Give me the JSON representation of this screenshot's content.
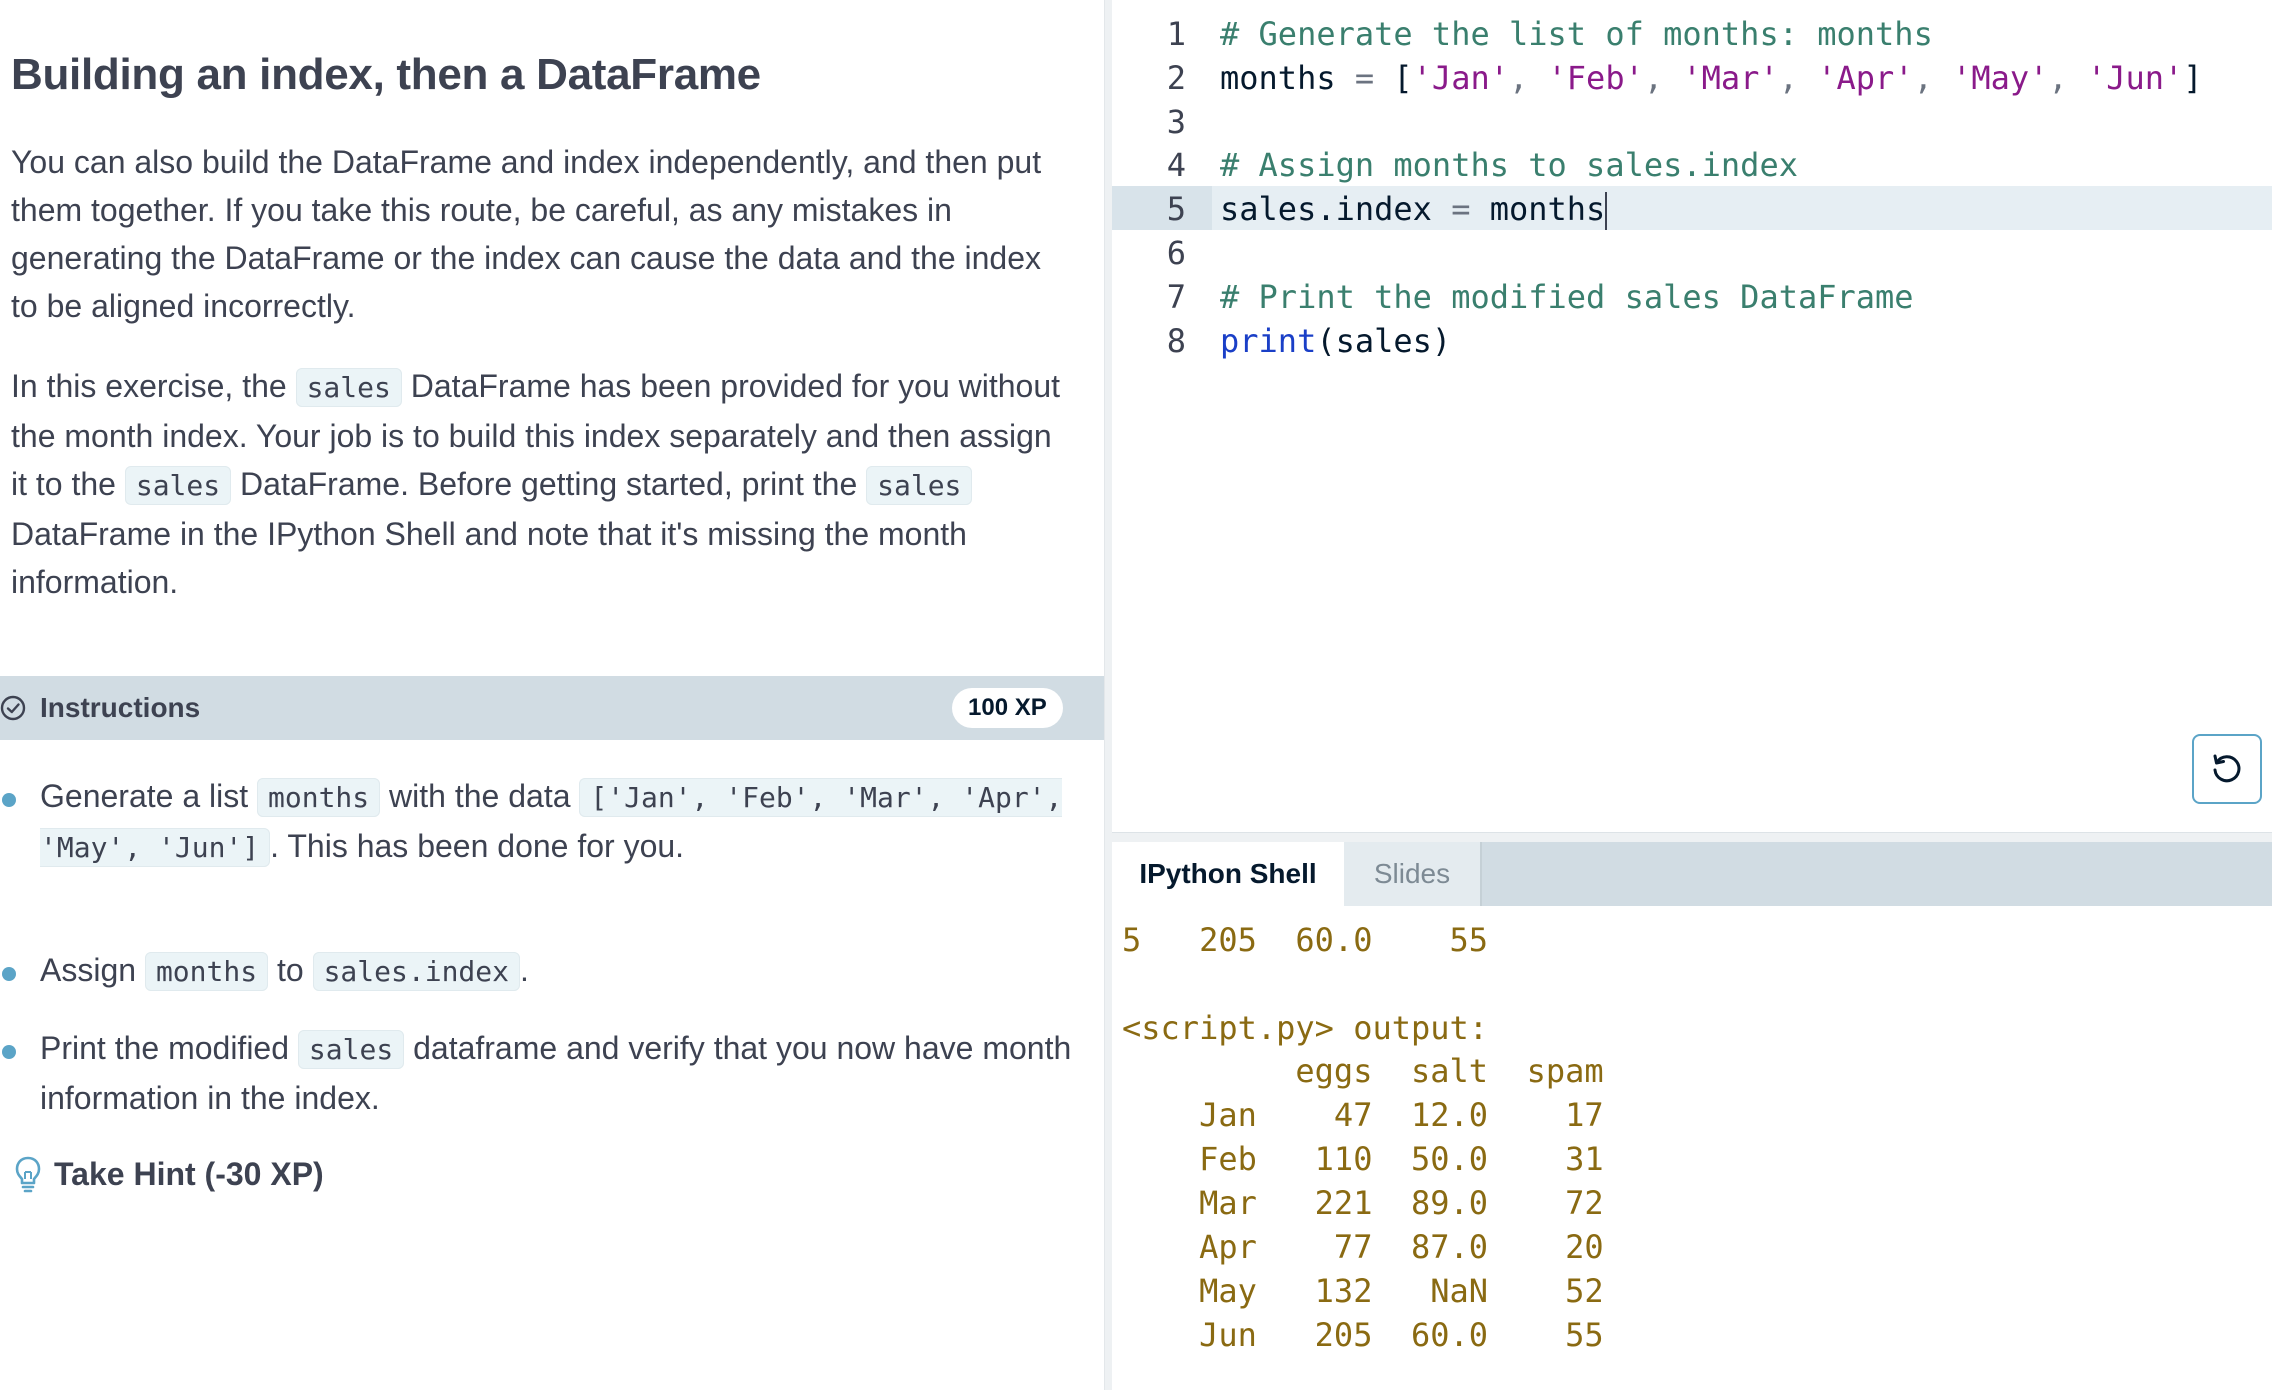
{
  "lesson": {
    "title": "Building an index, then a DataFrame",
    "para1": "You can also build the DataFrame and index independently, and then put them together. If you take this route, be careful, as any mistakes in generating the DataFrame or the index can cause the data and the index to be aligned incorrectly.",
    "para2_a": "In this exercise, the ",
    "para2_code1": "sales",
    "para2_b": " DataFrame has been provided for you without the month index. Your job is to build this index separately and then assign it to the ",
    "para2_code2": "sales",
    "para2_c": " DataFrame. Before getting started, print the ",
    "para2_code3": "sales",
    "para2_d": " DataFrame in the IPython Shell and note that it's missing the month information."
  },
  "instructions": {
    "label": "Instructions",
    "xp": "100 XP",
    "b1_a": "Generate a list ",
    "b1_code1": "months",
    "b1_b": " with the data ",
    "b1_code2": "['Jan', 'Feb', 'Mar', 'Apr', 'May', 'Jun']",
    "b1_c": ". This has been done for you.",
    "b2_a": "Assign ",
    "b2_code1": "months",
    "b2_b": " to ",
    "b2_code2": "sales.index",
    "b2_c": ".",
    "b3_a": "Print the modified ",
    "b3_code1": "sales",
    "b3_b": " dataframe and verify that you now have month information in the index.",
    "hint": "Take Hint (-30 XP)"
  },
  "editor": {
    "line_numbers": [
      "1",
      "2",
      "3",
      "4",
      "5",
      "6",
      "7",
      "8"
    ],
    "l1": "# Generate the list of months: months",
    "l2_a": "months ",
    "l2_eq": "=",
    "l2_b": " [",
    "l2_s1": "'Jan'",
    "l2_s2": "'Feb'",
    "l2_s3": "'Mar'",
    "l2_s4": "'Apr'",
    "l2_s5": "'May'",
    "l2_s6": "'Jun'",
    "l2_comma": ", ",
    "l2_c": "]",
    "l4": "# Assign months to sales.index",
    "l5_a": "sales.index ",
    "l5_eq": "=",
    "l5_b": " months",
    "l7": "# Print the modified sales DataFrame",
    "l8_kw": "print",
    "l8_rest": "(sales)"
  },
  "shell": {
    "tab_shell": "IPython Shell",
    "tab_slides": "Slides",
    "lines": [
      "5   205  60.0    55",
      "",
      "<script.py> output:",
      "         eggs  salt  spam",
      "    Jan    47  12.0    17",
      "    Feb   110  50.0    31",
      "    Mar   221  89.0    72",
      "    Apr    77  87.0    20",
      "    May   132   NaN    52",
      "    Jun   205  60.0    55"
    ]
  },
  "colors": {
    "accent": "#5ba4c7",
    "bar": "#d1dce3",
    "comment": "#3a7f6e",
    "string": "#8a1a8a",
    "keyword": "#1a3fc7",
    "output": "#8a6a12"
  },
  "icons": {
    "instructions": "check-circle-icon",
    "hint": "lightbulb-icon",
    "reset": "reset-icon"
  }
}
